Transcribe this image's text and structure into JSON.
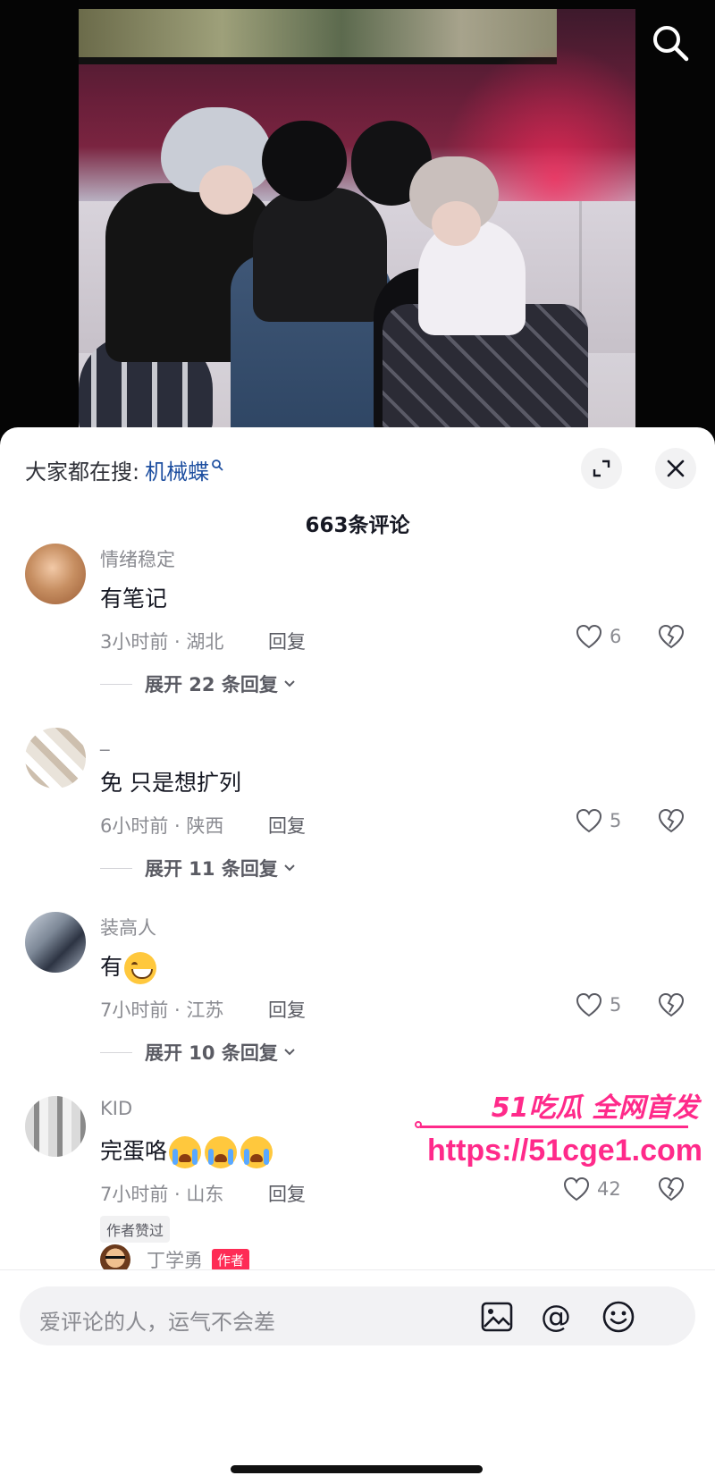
{
  "search_trend": {
    "prefix": "大家都在搜:",
    "keyword": "机械蝶"
  },
  "comment_count": "663条评论",
  "comments": [
    {
      "nickname": "情绪稳定",
      "text": "有笔记",
      "time_location": "3小时前 · 湖北",
      "reply_label": "回复",
      "likes": "6",
      "expand_label": "展开 22 条回复"
    },
    {
      "nickname": "_",
      "text": "免 只是想扩列",
      "time_location": "6小时前 · 陕西",
      "reply_label": "回复",
      "likes": "5",
      "expand_label": "展开 11 条回复"
    },
    {
      "nickname": "装高人",
      "text": "有",
      "emojis": [
        "grin-emoji"
      ],
      "time_location": "7小时前 · 江苏",
      "reply_label": "回复",
      "likes": "5",
      "expand_label": "展开 10 条回复"
    },
    {
      "nickname": "KID",
      "text": "完蛋咯",
      "emojis": [
        "crying-emoji",
        "crying-emoji",
        "crying-emoji"
      ],
      "time_location": "7小时前 · 山东",
      "reply_label": "回复",
      "likes": "42",
      "author_liked": "作者赞过"
    }
  ],
  "reply_preview": {
    "name": "丁学勇",
    "tag": "作者"
  },
  "watermark": {
    "brand": "51吃瓜 全网首发",
    "url": "https://51cge1.com"
  },
  "input": {
    "placeholder": "爱评论的人，运气不会差"
  },
  "icons": {
    "search": "search-icon",
    "expand": "expand-icon",
    "close": "close-icon",
    "like": "heart-icon",
    "dislike": "broken-heart-icon",
    "image": "image-icon",
    "mention": "at-icon",
    "emoji": "emoji-icon"
  },
  "colors": {
    "accent_link": "#1e4fa0",
    "author_tag": "#fe2c55",
    "watermark": "#ff2a8a"
  }
}
